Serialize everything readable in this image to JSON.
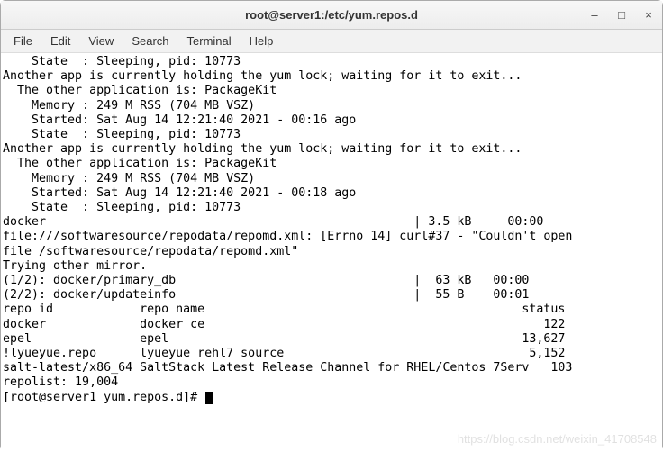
{
  "window": {
    "title": "root@server1:/etc/yum.repos.d",
    "controls": {
      "minimize": "–",
      "maximize": "□",
      "close": "×"
    }
  },
  "menubar": {
    "file": "File",
    "edit": "Edit",
    "view": "View",
    "search": "Search",
    "terminal": "Terminal",
    "help": "Help"
  },
  "terminal_lines": [
    "    State  : Sleeping, pid: 10773",
    "Another app is currently holding the yum lock; waiting for it to exit...",
    "  The other application is: PackageKit",
    "    Memory : 249 M RSS (704 MB VSZ)",
    "    Started: Sat Aug 14 12:21:40 2021 - 00:16 ago",
    "    State  : Sleeping, pid: 10773",
    "Another app is currently holding the yum lock; waiting for it to exit...",
    "  The other application is: PackageKit",
    "    Memory : 249 M RSS (704 MB VSZ)",
    "    Started: Sat Aug 14 12:21:40 2021 - 00:18 ago",
    "    State  : Sleeping, pid: 10773",
    "docker                                                   | 3.5 kB     00:00",
    "file:///softwaresource/repodata/repomd.xml: [Errno 14] curl#37 - \"Couldn't open",
    "file /softwaresource/repodata/repomd.xml\"",
    "Trying other mirror.",
    "(1/2): docker/primary_db                                 |  63 kB   00:00",
    "(2/2): docker/updateinfo                                 |  55 B    00:01",
    "repo id            repo name                                            status",
    "docker             docker ce                                               122",
    "epel               epel                                                 13,627",
    "!lyueyue.repo      lyueyue rehl7 source                                  5,152",
    "salt-latest/x86_64 SaltStack Latest Release Channel for RHEL/Centos 7Serv   103",
    "repolist: 19,004"
  ],
  "prompt": "[root@server1 yum.repos.d]# ",
  "watermark": "https://blog.csdn.net/weixin_41708548"
}
